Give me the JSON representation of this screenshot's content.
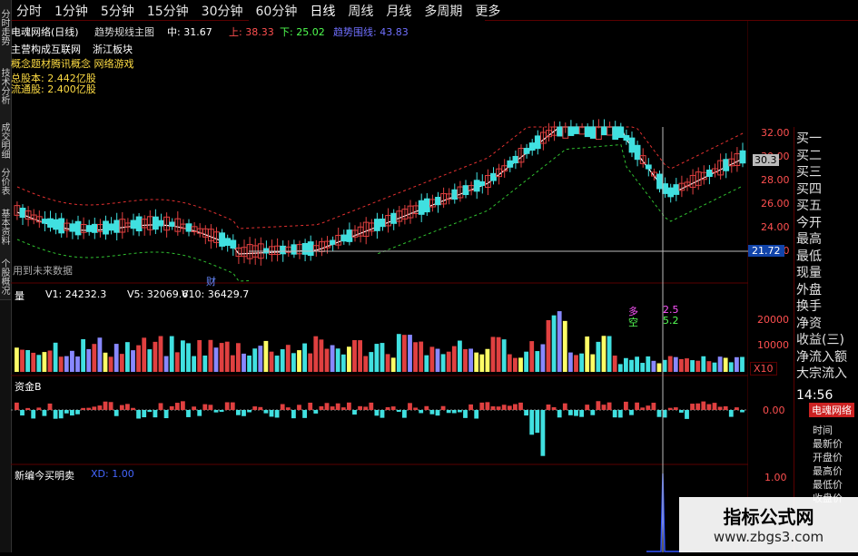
{
  "periods": [
    "分时",
    "1分钟",
    "5分钟",
    "15分钟",
    "30分钟",
    "60分钟",
    "日线",
    "周线",
    "月线",
    "多周期",
    "更多"
  ],
  "side_tabs": [
    "分时走势",
    "技术分析",
    "成交明细",
    "分价表",
    "基本资料",
    "个股概况"
  ],
  "header": {
    "stock": "电魂网络(日线)",
    "indicator": "趋势规线主图",
    "mid_label": "中: 31.67",
    "up_label": "上: 38.33",
    "down_label": "下: 25.02",
    "trend_label": "趋势围线: 43.83"
  },
  "info": {
    "main_business": "主营构成互联网",
    "zhejiang": "浙江板块",
    "concept": "概念题材腾讯概念 网络游戏",
    "total_shares": "总股本: 2.442亿股",
    "float_shares": "流通股: 2.400亿股"
  },
  "chart_note": "用到未来数据",
  "cai_marker": "财",
  "price_axis": [
    "32.00",
    "30.00",
    "28.00",
    "26.00",
    "24.00",
    "22.00"
  ],
  "price_current": "30.3",
  "price_cursor": "21.72",
  "volume": {
    "title": "量",
    "v1": "V1: 24232.3",
    "v5": "V5: 32069.6",
    "v10": "V10: 36429.7",
    "axis": [
      "20000",
      "10000"
    ],
    "unit": "X10",
    "duo_label": "多",
    "duo_val": "2.5",
    "kong_label": "空",
    "kong_val": "5.2"
  },
  "fund": {
    "title": "资金B",
    "axis": "0.00"
  },
  "signal": {
    "title": "新编今买明卖",
    "xd": "XD: 1.00",
    "axis": "1.00"
  },
  "right_panel": {
    "rows": [
      "买一",
      "买二",
      "买三",
      "买四",
      "买五",
      "今开",
      "最高",
      "最低",
      "现量",
      "外盘",
      "换手",
      "净资",
      "收益(三)",
      "净流入额",
      "大宗流入"
    ],
    "time": "14:56",
    "stock_tag": "电魂网络",
    "fields": [
      "时间",
      "最新价",
      "开盘价",
      "最高价",
      "最低价",
      "收盘价"
    ]
  },
  "watermark": {
    "title": "指标公式网",
    "url": "www.zbgs3.com"
  },
  "colors": {
    "up": "#e04040",
    "down": "#40e0e0",
    "grid": "#5a0000",
    "bg": "#000000"
  }
}
